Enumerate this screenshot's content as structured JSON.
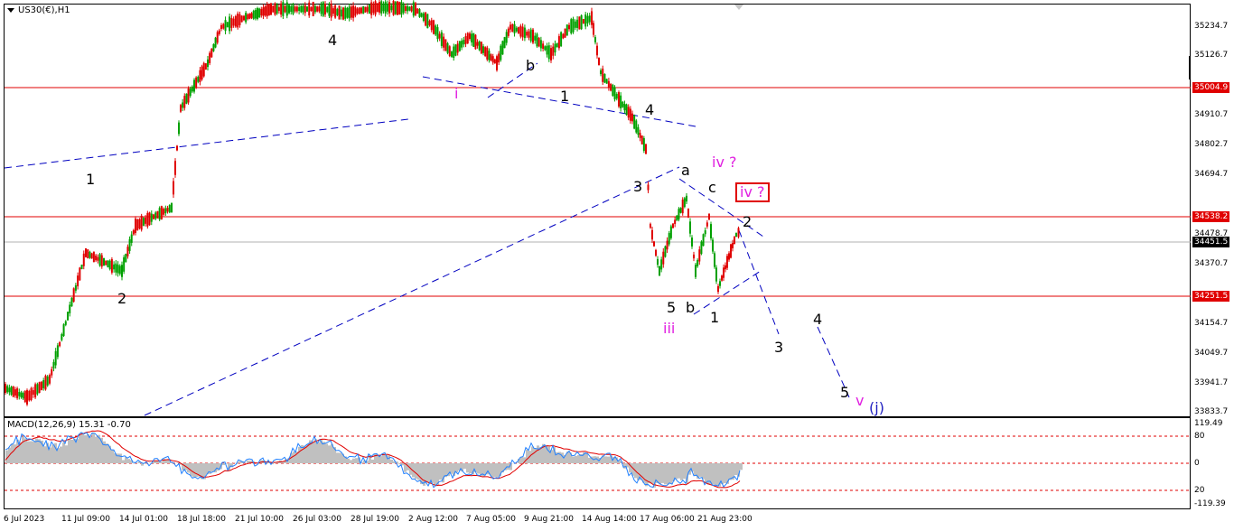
{
  "symbol": "US30(€),H1",
  "macd_label": "MACD(12,26,9) 15.31 -0.70",
  "price_axis": [
    "35234.7",
    "35126.7",
    "34910.7",
    "34802.7",
    "34694.7",
    "34478.7",
    "34370.7",
    "34154.7",
    "34049.7",
    "33941.7",
    "33833.7"
  ],
  "price_tags": {
    "level_1": "35004.9",
    "level_2": "34538.2",
    "current": "34451.5",
    "level_3": "34251.5"
  },
  "macd_axis": [
    "119.49",
    "80",
    "0",
    "20",
    "-119.39"
  ],
  "time_axis": [
    "6 Jul 2023",
    "11 Jul 09:00",
    "14 Jul 01:00",
    "18 Jul 18:00",
    "21 Jul 10:00",
    "26 Jul 03:00",
    "28 Jul 19:00",
    "2 Aug 12:00",
    "7 Aug 05:00",
    "9 Aug 21:00",
    "14 Aug 14:00",
    "17 Aug 06:00",
    "21 Aug 23:00"
  ],
  "waves": {
    "w1": "1",
    "w2": "2",
    "w4a": "4",
    "wi": "i",
    "wb1": "b",
    "w1b": "1",
    "w4b": "4",
    "w3": "3",
    "wa": "a",
    "wc": "c",
    "wiv1": "iv ?",
    "wiv2": "iv ?",
    "w2b": "2",
    "w5": "5",
    "wb2": "b",
    "w1c": "1",
    "wiii": "iii",
    "w3c": "3",
    "w4c": "4",
    "w5c": "5",
    "wv": "v",
    "wj": "(j)"
  },
  "colors": {
    "bull": "#00a000",
    "bear": "#e00000",
    "trend": "#0000c0",
    "level": "#e00000",
    "wave_pink": "#e020e0"
  }
}
